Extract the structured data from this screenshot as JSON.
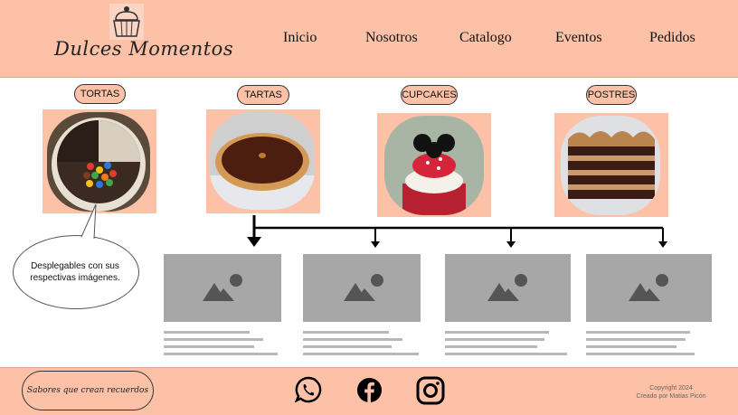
{
  "brand": {
    "name": "Dulces Momentos"
  },
  "nav": {
    "inicio": "Inicio",
    "nosotros": "Nosotros",
    "catalogo": "Catalogo",
    "eventos": "Eventos",
    "pedidos": "Pedidos"
  },
  "categories": {
    "tortas": "TORTAS",
    "tartas": "TARTAS",
    "cupcakes": "CUPCAKES",
    "postres": "POSTRES"
  },
  "callout": {
    "text": "Desplegables con sus respectivas imágenes."
  },
  "footer": {
    "slogan": "Sabores que crean recuerdos",
    "copyright_line1": "Copyright 2024",
    "copyright_line2": "Creado por Matias Picón"
  },
  "social": {
    "icons": [
      "whatsapp-icon",
      "facebook-icon",
      "instagram-icon"
    ]
  },
  "colors": {
    "accent": "#fdc1a8",
    "placeholder": "#a7a7a7"
  }
}
